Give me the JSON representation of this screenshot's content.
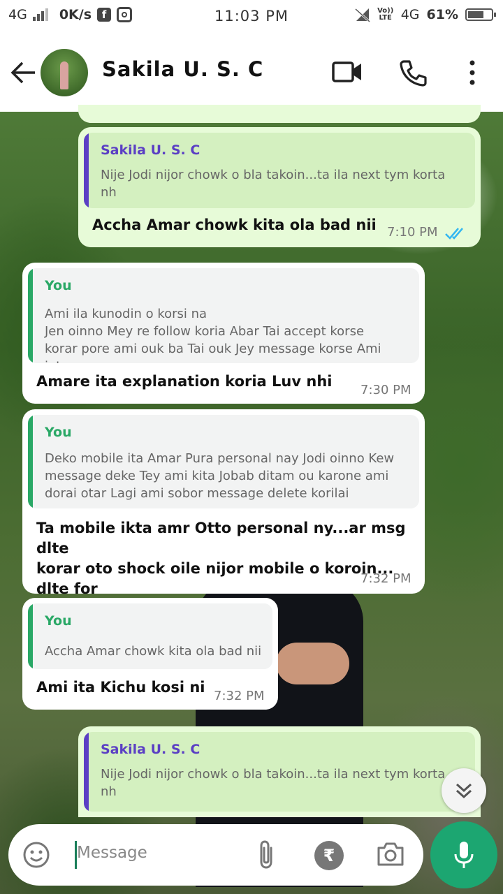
{
  "status_bar": {
    "network": "4G",
    "speed": "0K/s",
    "time": "11:03 PM",
    "volte": "Vo)) LTE",
    "network2": "4G",
    "battery": "61%"
  },
  "header": {
    "contact_name": "Sakila U. S. C"
  },
  "messages": [
    {
      "direction": "out",
      "quote_author": "Sakila U. S. C",
      "quote_text": "Nije Jodi nijor chowk o bla takoin...ta ila next tym korta\nnh",
      "text": "Accha Amar chowk kita ola bad nii",
      "time": "7:10 PM"
    },
    {
      "direction": "in",
      "quote_author": "You",
      "quote_text": "Ami ila kunodin o korsi na\nJen oinno Mey re follow koria Abar Tai accept korse\nkorar pore ami ouk ba Tai ouk Jey message korse Ami jet...",
      "text": "Amare ita explanation koria Luv nhi",
      "time": "7:30 PM"
    },
    {
      "direction": "in",
      "quote_author": "You",
      "quote_text": "Deko mobile ita Amar Pura personal nay Jodi oinno Kew\nmessage deke Tey ami kita Jobab ditam ou karone ami\ndorai otar Lagi ami sobor message delete korilai",
      "text": "Ta mobile ikta amr Otto personal ny...ar msg dlte\nkorar oto shock oile nijor mobile o koroin... dlte for\neveryone maroin knee??",
      "time": "7:32 PM"
    },
    {
      "direction": "in",
      "quote_author": "You",
      "quote_text": "Accha Amar chowk kita ola bad nii",
      "text": "Ami ita Kichu kosi ni",
      "time": "7:32 PM"
    },
    {
      "direction": "out",
      "quote_author": "Sakila U. S. C",
      "quote_text": "Nije Jodi nijor chowk o bla takoin...ta ila next tym korta\nnh",
      "text": "",
      "time": ""
    }
  ],
  "input": {
    "placeholder": "Message"
  },
  "colors": {
    "outgoing_bubble": "#e7fbd8",
    "incoming_bubble": "#ffffff",
    "quote_you": "#2aa866",
    "quote_contact": "#5b3fc4",
    "read_ticks": "#34b7f1",
    "mic_button": "#1ca671"
  },
  "icons": [
    "back-arrow-icon",
    "video-call-icon",
    "phone-icon",
    "more-vertical-icon",
    "emoji-icon",
    "attachment-icon",
    "rupee-icon",
    "camera-icon",
    "mic-icon",
    "scroll-down-icon",
    "read-receipt-icon"
  ]
}
